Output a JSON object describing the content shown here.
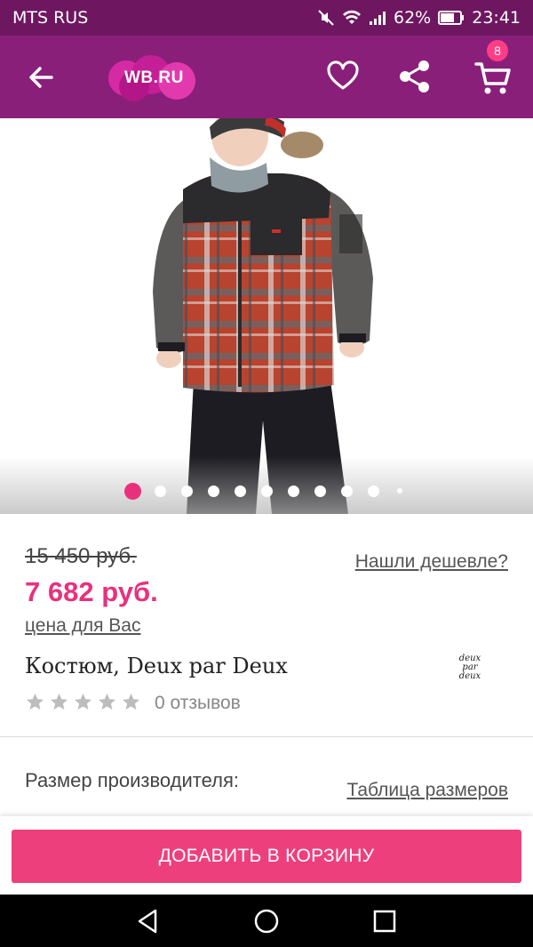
{
  "status_bar": {
    "carrier": "MTS RUS",
    "battery": "62%",
    "time": "23:41"
  },
  "app_bar": {
    "logo_text": "WB.RU",
    "cart_count": "8"
  },
  "gallery": {
    "image_count": 11,
    "active_index": 0
  },
  "product": {
    "old_price": "15 450 руб.",
    "new_price": "7 682 руб.",
    "price_for_you": "цена для Вас",
    "cheaper_link": "Нашли дешевле?",
    "title": "Костюм, Deux par Deux",
    "brand_logo": [
      "deux",
      "par",
      "deux"
    ],
    "rating": 0,
    "rating_max": 5,
    "reviews": "0 отзывов",
    "size_label": "Размер производителя:",
    "size_table_link": "Таблица размеров"
  },
  "actions": {
    "add_to_cart": "ДОБАВИТЬ В КОРЗИНУ"
  },
  "colors": {
    "status_bar": "#6e1760",
    "app_bar": "#8a1f7a",
    "accent": "#e8317d",
    "button": "#ee3f7d"
  },
  "icons": {
    "back": "arrow-left-icon",
    "favorite": "heart-icon",
    "share": "share-icon",
    "cart": "cart-icon"
  }
}
